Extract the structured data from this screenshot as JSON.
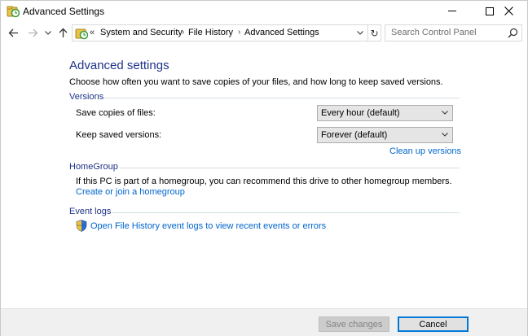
{
  "window": {
    "title": "Advanced Settings"
  },
  "titlebar_buttons": {
    "minimize_icon": "minimize-icon",
    "maximize_icon": "maximize-icon",
    "close_icon": "close-icon"
  },
  "address": {
    "overflow": "«",
    "crumbs": [
      "System and Security",
      "File History",
      "Advanced Settings"
    ],
    "refresh_glyph": "↻"
  },
  "search": {
    "placeholder": "Search Control Panel"
  },
  "page": {
    "title": "Advanced settings",
    "description": "Choose how often you want to save copies of your files, and how long to keep saved versions."
  },
  "versions": {
    "header": "Versions",
    "save_copies_label": "Save copies of files:",
    "save_copies_value": "Every hour (default)",
    "keep_label": "Keep saved versions:",
    "keep_value": "Forever (default)",
    "cleanup_link": "Clean up versions"
  },
  "homegroup": {
    "header": "HomeGroup",
    "text": "If this PC is part of a homegroup, you can recommend this drive to other homegroup members.",
    "link": "Create or join a homegroup"
  },
  "event_logs": {
    "header": "Event logs",
    "link": "Open File History event logs to view recent events or errors"
  },
  "footer": {
    "save_label": "Save changes",
    "cancel_label": "Cancel"
  },
  "colors": {
    "heading_blue": "#1e3287",
    "link_blue": "#0066cc",
    "section_line": "#d5dfe5",
    "accent": "#0078d7"
  }
}
